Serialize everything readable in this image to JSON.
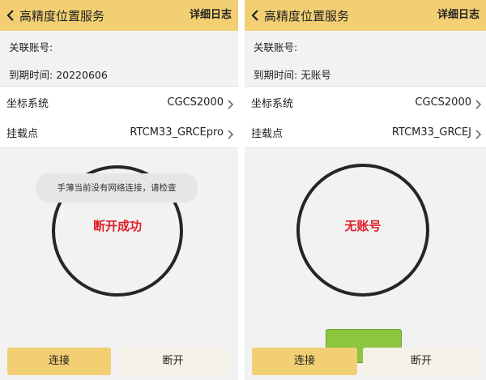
{
  "left": {
    "title": "高精度位置服务",
    "log_label": "详细日志",
    "account_label": "关联账号:",
    "expiry_label": "到期时间:",
    "expiry_value": "20220606",
    "coord_label": "坐标系统",
    "coord_value": "CGCS2000",
    "mount_label": "挂载点",
    "mount_value": "RTCM33_GRCEpro",
    "status": "断开成功",
    "toast": "手薄当前没有网络连接，请检查",
    "connect_label": "连接",
    "disconnect_label": "断开"
  },
  "right": {
    "title": "高精度位置服务",
    "log_label": "详细日志",
    "account_label": "关联账号:",
    "expiry_label": "到期时间:",
    "expiry_value": "无账号",
    "coord_label": "坐标系统",
    "coord_value": "CGCS2000",
    "mount_label": "挂载点",
    "mount_value": "RTCM33_GRCEJ",
    "status": "无账号",
    "connect_label": "连接",
    "disconnect_label": "断开"
  },
  "icons": {
    "back": "chevron-left-icon",
    "forward": "chevron-right-icon"
  },
  "colors": {
    "header": "#f3cf73",
    "status_red": "#e0202a",
    "ring": "#262626"
  }
}
